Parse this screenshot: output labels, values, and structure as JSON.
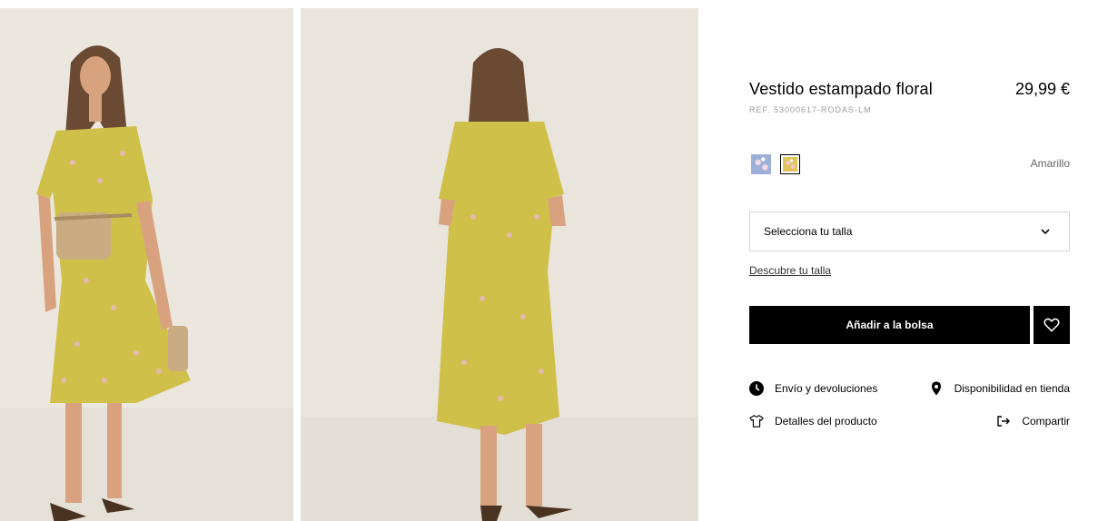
{
  "product": {
    "title": "Vestido estampado floral",
    "price": "29,99 €",
    "ref": "REF. 53000617-RODAS-LM"
  },
  "colors": {
    "selected_name": "Amarillo",
    "swatches": [
      {
        "icon": "blue-floral-swatch",
        "color": "#9db0d8",
        "selected": false
      },
      {
        "icon": "yellow-floral-swatch",
        "color": "#e2c55a",
        "selected": true
      }
    ]
  },
  "size": {
    "select_label": "Selecciona tu talla",
    "guide_link": "Descubre tu talla"
  },
  "actions": {
    "add_to_bag": "Añadir a la bolsa",
    "wishlist_icon": "heart-icon"
  },
  "links": {
    "shipping": "Envío y devoluciones",
    "store_availability": "Disponibilidad en tienda",
    "product_details": "Detalles del producto",
    "share": "Compartir"
  },
  "theme": {
    "background": "#ffffff",
    "photo_background": "#ebe7df",
    "dress_color": "#cfc04a",
    "button": "#000000",
    "muted_text": "#9c9c9c"
  }
}
